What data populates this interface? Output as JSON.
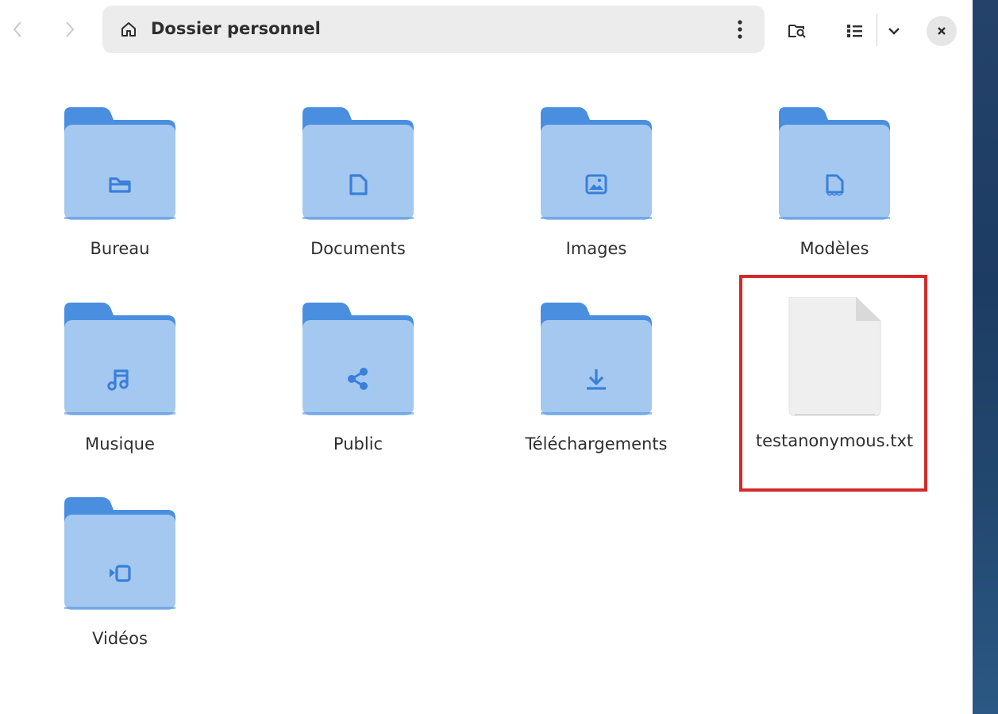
{
  "header": {
    "path_label": "Dossier personnel",
    "back_icon": "chevron-left-icon",
    "forward_icon": "chevron-right-icon",
    "home_icon": "home-icon",
    "menu_icon": "vertical-dots-icon",
    "search_icon": "folder-search-icon",
    "view_icon": "list-view-icon",
    "view_dropdown_icon": "chevron-down-icon",
    "close_icon": "close-icon"
  },
  "items": [
    {
      "label": "Bureau",
      "kind": "folder",
      "emblem": "folder-emblem"
    },
    {
      "label": "Documents",
      "kind": "folder",
      "emblem": "document-emblem"
    },
    {
      "label": "Images",
      "kind": "folder",
      "emblem": "image-emblem"
    },
    {
      "label": "Modèles",
      "kind": "folder",
      "emblem": "template-emblem"
    },
    {
      "label": "Musique",
      "kind": "folder",
      "emblem": "music-emblem"
    },
    {
      "label": "Public",
      "kind": "folder",
      "emblem": "share-emblem"
    },
    {
      "label": "Téléchargements",
      "kind": "folder",
      "emblem": "download-emblem"
    },
    {
      "label": "testanonymous.txt",
      "kind": "file",
      "emblem": "text-file-icon"
    },
    {
      "label": "Vidéos",
      "kind": "folder",
      "emblem": "video-emblem"
    }
  ],
  "colors": {
    "folder_back": "#4a8ee0",
    "folder_front": "#a4c8f0",
    "folder_emblem": "#3a7fd8",
    "highlight": "#d42a2a"
  }
}
